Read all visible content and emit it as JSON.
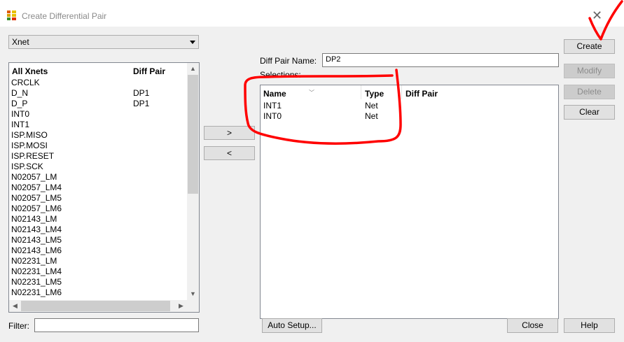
{
  "window": {
    "title": "Create Differential Pair",
    "close_glyph": "✕"
  },
  "type_select": {
    "value": "Xnet"
  },
  "net_list": {
    "col_names": "All Xnets",
    "col_diffpair": "Diff Pair",
    "rows": [
      {
        "name": "CRCLK",
        "pair": ""
      },
      {
        "name": "D_N",
        "pair": "DP1"
      },
      {
        "name": "D_P",
        "pair": "DP1"
      },
      {
        "name": "INT0",
        "pair": ""
      },
      {
        "name": "INT1",
        "pair": ""
      },
      {
        "name": "ISP.MISO",
        "pair": ""
      },
      {
        "name": "ISP.MOSI",
        "pair": ""
      },
      {
        "name": "ISP.RESET",
        "pair": ""
      },
      {
        "name": "ISP.SCK",
        "pair": ""
      },
      {
        "name": "N02057_LM",
        "pair": ""
      },
      {
        "name": "N02057_LM4",
        "pair": ""
      },
      {
        "name": "N02057_LM5",
        "pair": ""
      },
      {
        "name": "N02057_LM6",
        "pair": ""
      },
      {
        "name": "N02143_LM",
        "pair": ""
      },
      {
        "name": "N02143_LM4",
        "pair": ""
      },
      {
        "name": "N02143_LM5",
        "pair": ""
      },
      {
        "name": "N02143_LM6",
        "pair": ""
      },
      {
        "name": "N02231_LM",
        "pair": ""
      },
      {
        "name": "N02231_LM4",
        "pair": ""
      },
      {
        "name": "N02231_LM5",
        "pair": ""
      },
      {
        "name": "N02231_LM6",
        "pair": ""
      }
    ]
  },
  "filter": {
    "label": "Filter:",
    "value": ""
  },
  "move": {
    "add_label": ">",
    "remove_label": "<"
  },
  "diff_pair_name": {
    "label": "Diff Pair Name:",
    "value": "DP2"
  },
  "selections": {
    "label": "Selections:",
    "col_name": "Name",
    "col_type": "Type",
    "col_diffpair": "Diff Pair",
    "rows": [
      {
        "name": "INT1",
        "type": "Net",
        "pair": ""
      },
      {
        "name": "INT0",
        "type": "Net",
        "pair": ""
      }
    ]
  },
  "buttons": {
    "create": "Create",
    "modify": "Modify",
    "delete": "Delete",
    "clear": "Clear",
    "auto_setup": "Auto Setup...",
    "close": "Close",
    "help": "Help"
  },
  "annotation_color": "#ff0000"
}
